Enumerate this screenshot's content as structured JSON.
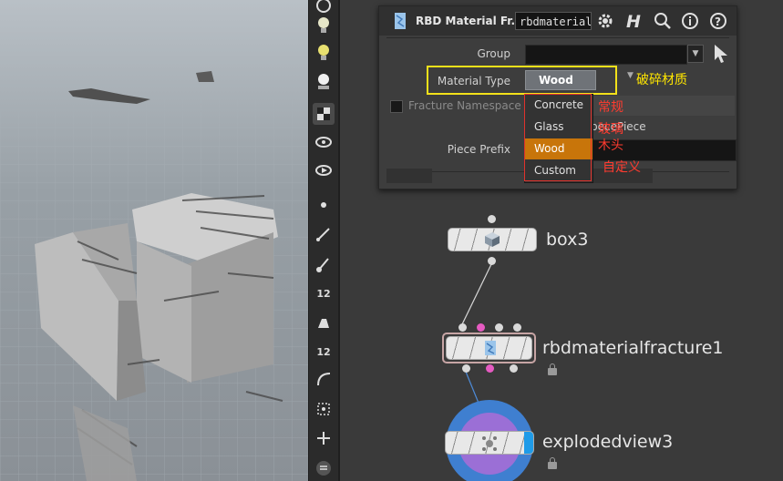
{
  "panel": {
    "node_type": "RBD Material Fr...",
    "node_name": "rbdmaterialfracture1",
    "icons": [
      "node-type-icon",
      "gear-icon",
      "help-h-icon",
      "search-icon",
      "info-icon",
      "help-icon"
    ]
  },
  "params": {
    "group_label": "Group",
    "group_value": "",
    "material_type_label": "Material Type",
    "material_type_value": "Wood",
    "material_type_cn": "破碎材质",
    "fracture_namespace_label": "Fracture Namespace",
    "fracture_namespace_value": "pecePiece",
    "piece_prefix_label": "Piece Prefix"
  },
  "dropdown": {
    "options": [
      "Concrete",
      "Glass",
      "Wood",
      "Custom"
    ],
    "selected": "Wood",
    "annotations": [
      "常规",
      "玻璃",
      "木头",
      "自定义"
    ]
  },
  "toolbar": {
    "items": [
      "handle-icon",
      "light-icon",
      "point-light-icon",
      "spot-light-icon",
      "display-icon",
      "camera-icon",
      "camera-flipbook-icon",
      "point-icon",
      "edge-icon",
      "brush-icon",
      "num-12-icon",
      "paint-icon",
      "num-12-b-icon",
      "curve-icon",
      "snap-icon",
      "pivot-icon",
      "menu-icon"
    ],
    "badge_1": "12",
    "badge_2": "12"
  },
  "nodes": [
    {
      "name": "box3"
    },
    {
      "name": "rbdmaterialfracture1"
    },
    {
      "name": "explodedview3"
    }
  ],
  "colors": {
    "highlight_yellow": "#f3e11a",
    "annotation_red": "#ff3b2f",
    "dropdown_active": "#c8750a",
    "pink_port": "#e65bc2",
    "explode_blue": "#3f7fd0",
    "explode_purple": "#9b6fd6"
  }
}
